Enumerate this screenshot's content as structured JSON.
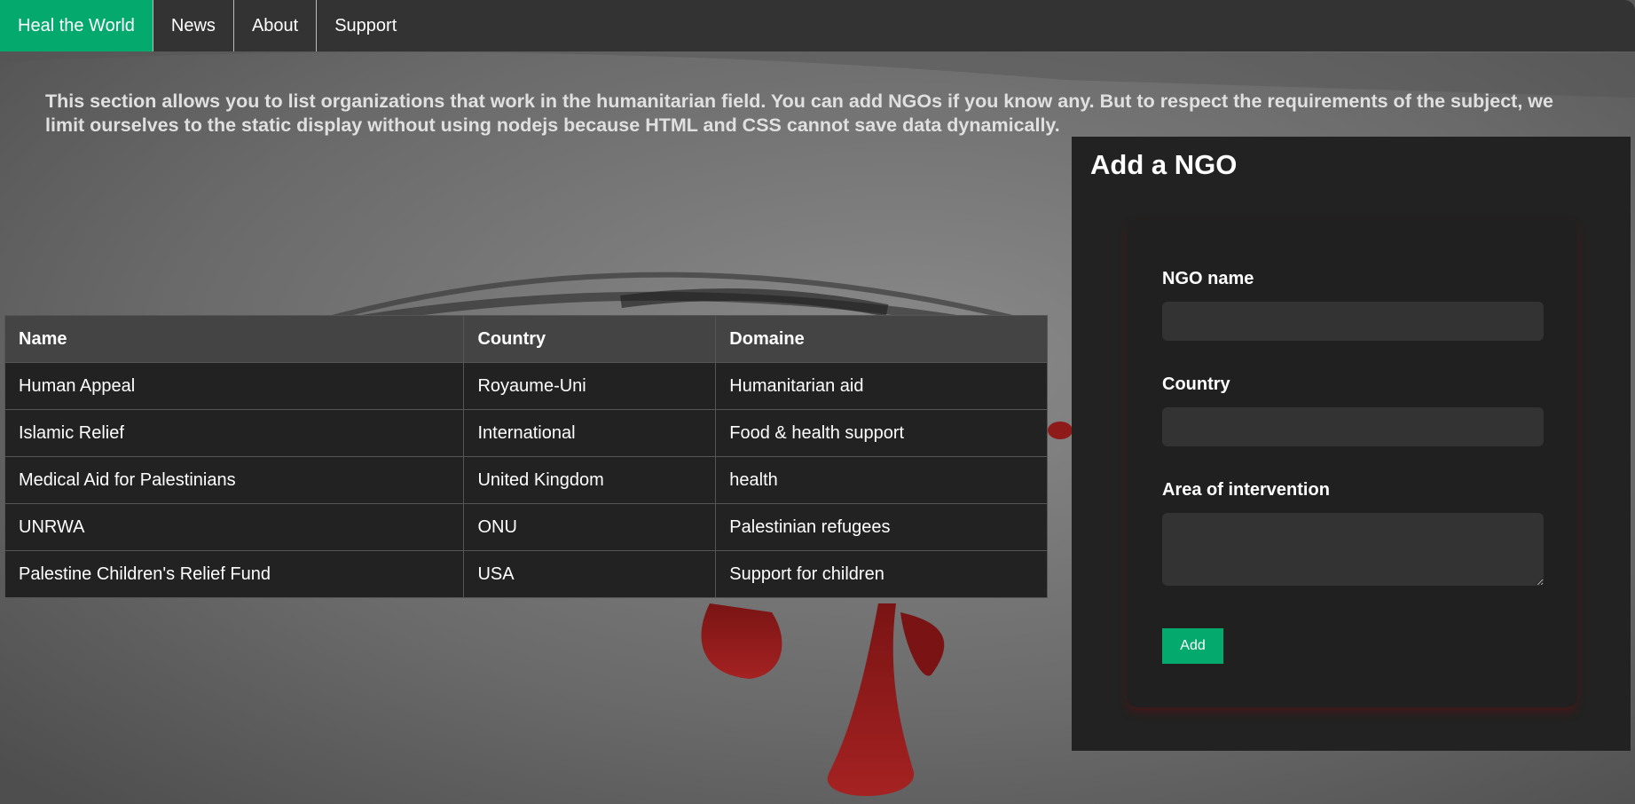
{
  "nav": {
    "items": [
      {
        "label": "Heal the World",
        "active": true
      },
      {
        "label": "News",
        "active": false
      },
      {
        "label": "About",
        "active": false
      },
      {
        "label": "Support",
        "active": false
      }
    ]
  },
  "intro": {
    "text": "This section allows you to list organizations that work in the humanitarian field. You can add NGOs if you know any. But to respect the requirements of the subject, we limit ourselves to the static display without using nodejs because HTML and CSS cannot save data dynamically."
  },
  "table": {
    "headers": [
      "Name",
      "Country",
      "Domaine"
    ],
    "rows": [
      [
        "Human Appeal",
        "Royaume-Uni",
        "Humanitarian aid"
      ],
      [
        "Islamic Relief",
        "International",
        "Food & health support"
      ],
      [
        "Medical Aid for Palestinians",
        "United Kingdom",
        "health"
      ],
      [
        "UNRWA",
        "ONU",
        "Palestinian refugees"
      ],
      [
        "Palestine Children's Relief Fund",
        "USA",
        "Support for children"
      ]
    ]
  },
  "form": {
    "title": "Add a NGO",
    "name_label": "NGO name",
    "name_value": "",
    "country_label": "Country",
    "country_value": "",
    "area_label": "Area of intervention",
    "area_value": "",
    "submit_label": "Add"
  },
  "colors": {
    "accent": "#04AA6D",
    "navbar": "#333333",
    "panel": "#222222",
    "table_header": "#444444",
    "table_cell": "#222222",
    "blood": "#8e1a1a"
  }
}
